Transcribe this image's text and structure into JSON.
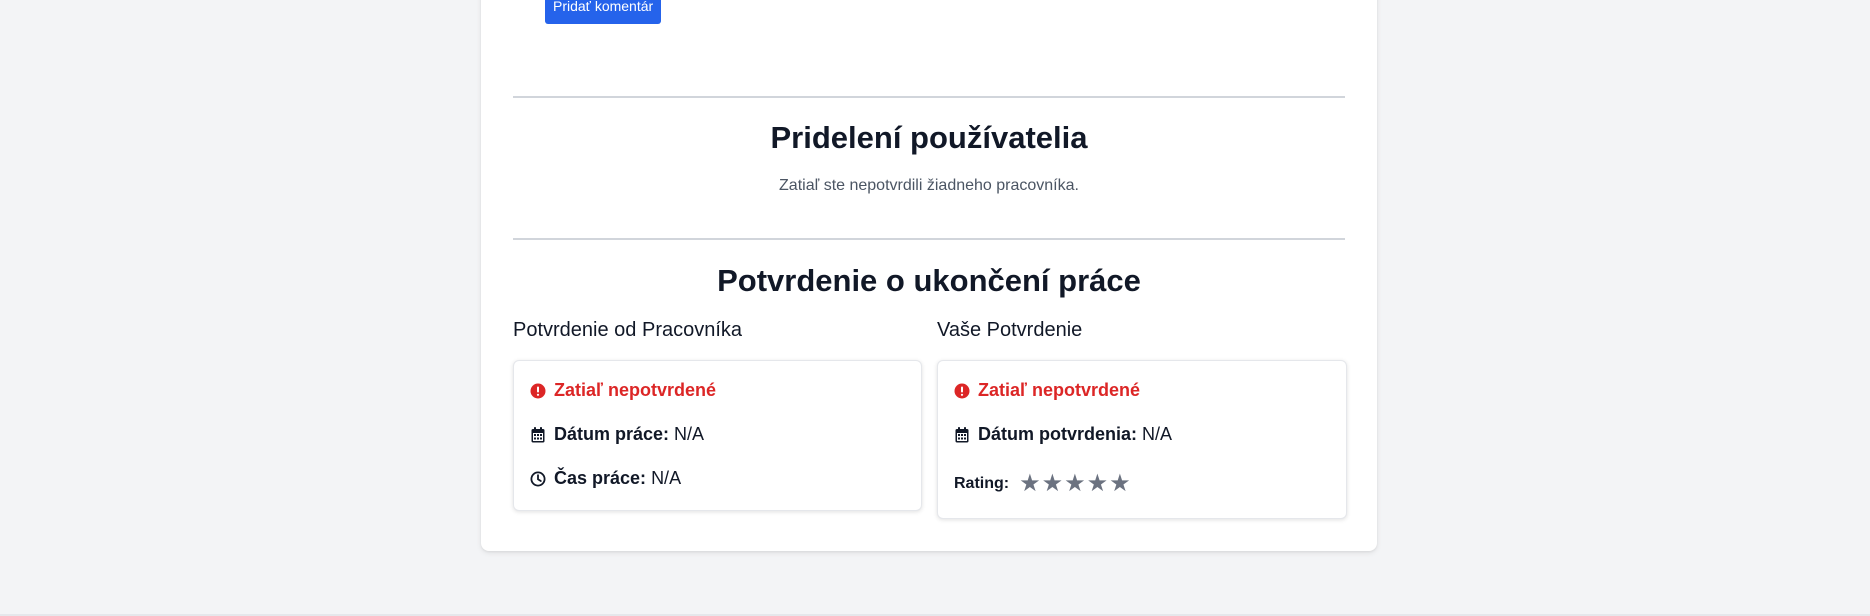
{
  "comment": {
    "add_button_label": "Pridať komentár"
  },
  "assignment": {
    "title": "Pridelení používatelia",
    "empty_text": "Zatiaľ ste nepotvrdili žiadneho pracovníka."
  },
  "completion": {
    "title": "Potvrdenie o ukončení práce",
    "worker": {
      "heading": "Potvrdenie od Pracovníka",
      "status": "Zatiaľ nepotvrdené",
      "date_label": "Dátum práce:",
      "date_value": "N/A",
      "time_label": "Čas práce:",
      "time_value": "N/A"
    },
    "yours": {
      "heading": "Vaše Potvrdenie",
      "status": "Zatiaľ nepotvrdené",
      "date_label": "Dátum potvrdenia:",
      "date_value": "N/A",
      "rating_label": "Rating:",
      "rating_value": 0,
      "rating_max": 5
    }
  },
  "icons": {
    "status": "exclamation-circle-icon",
    "date": "calendar-icon",
    "time": "clock-icon",
    "star": "star-icon"
  },
  "colors": {
    "page_bg": "#f3f4f6",
    "primary_button": "#2563eb",
    "status_red": "#dc2626",
    "star_gray": "#6b7280"
  }
}
